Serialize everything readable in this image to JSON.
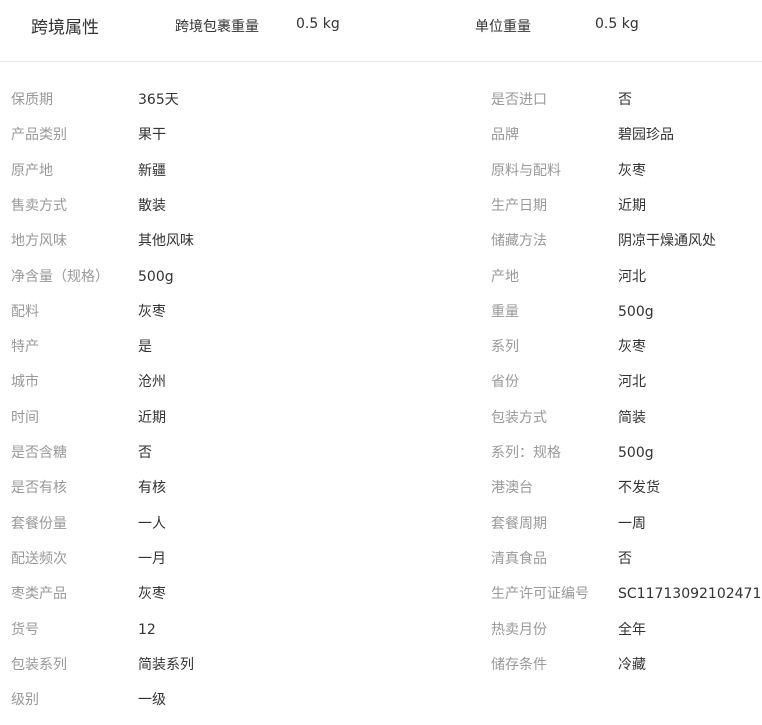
{
  "header": {
    "title": "跨境属性",
    "items": [
      {
        "label": "跨境包裹重量",
        "value": "0.5 kg"
      },
      {
        "label": "单位重量",
        "value": "0.5 kg"
      }
    ]
  },
  "attributes": [
    {
      "left": {
        "label": "保质期",
        "value": "365天"
      },
      "right": {
        "label": "是否进口",
        "value": "否"
      }
    },
    {
      "left": {
        "label": "产品类别",
        "value": "果干"
      },
      "right": {
        "label": "品牌",
        "value": "碧园珍品"
      }
    },
    {
      "left": {
        "label": "原产地",
        "value": "新疆"
      },
      "right": {
        "label": "原料与配料",
        "value": "灰枣"
      }
    },
    {
      "left": {
        "label": "售卖方式",
        "value": "散装"
      },
      "right": {
        "label": "生产日期",
        "value": "近期"
      }
    },
    {
      "left": {
        "label": "地方风味",
        "value": "其他风味"
      },
      "right": {
        "label": "储藏方法",
        "value": "阴凉干燥通风处"
      }
    },
    {
      "left": {
        "label": "净含量（规格）",
        "value": "500g"
      },
      "right": {
        "label": "产地",
        "value": "河北"
      }
    },
    {
      "left": {
        "label": "配料",
        "value": "灰枣"
      },
      "right": {
        "label": "重量",
        "value": "500g"
      }
    },
    {
      "left": {
        "label": "特产",
        "value": "是"
      },
      "right": {
        "label": "系列",
        "value": "灰枣"
      }
    },
    {
      "left": {
        "label": "城市",
        "value": "沧州"
      },
      "right": {
        "label": "省份",
        "value": "河北"
      }
    },
    {
      "left": {
        "label": "时间",
        "value": "近期"
      },
      "right": {
        "label": "包装方式",
        "value": "简装"
      }
    },
    {
      "left": {
        "label": "是否含糖",
        "value": "否"
      },
      "right": {
        "label": "系列：规格",
        "value": "500g"
      }
    },
    {
      "left": {
        "label": "是否有核",
        "value": "有核"
      },
      "right": {
        "label": "港澳台",
        "value": "不发货"
      }
    },
    {
      "left": {
        "label": "套餐份量",
        "value": "一人"
      },
      "right": {
        "label": "套餐周期",
        "value": "一周"
      }
    },
    {
      "left": {
        "label": "配送频次",
        "value": "一月"
      },
      "right": {
        "label": "清真食品",
        "value": "否"
      }
    },
    {
      "left": {
        "label": "枣类产品",
        "value": "灰枣"
      },
      "right": {
        "label": "生产许可证编号",
        "value": "SC11713092102471"
      }
    },
    {
      "left": {
        "label": "货号",
        "value": "12"
      },
      "right": {
        "label": "热卖月份",
        "value": "全年"
      }
    },
    {
      "left": {
        "label": "包装系列",
        "value": "简装系列"
      },
      "right": {
        "label": "储存条件",
        "value": "冷藏"
      }
    },
    {
      "left": {
        "label": "级别",
        "value": "一级"
      },
      "right": null
    }
  ]
}
